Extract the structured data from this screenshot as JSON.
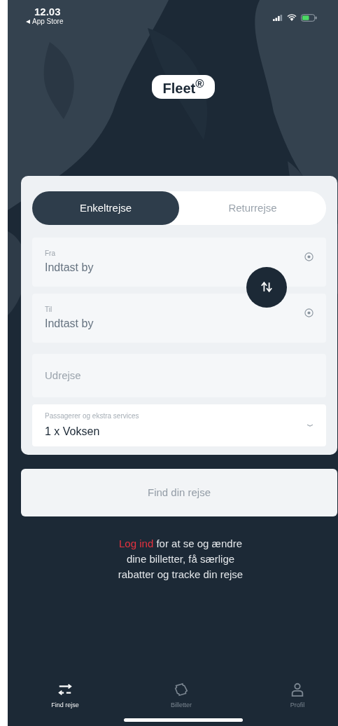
{
  "status_bar": {
    "time": "12.03",
    "back_label": "App Store"
  },
  "logo": {
    "text": "Fleet$^{®}$"
  },
  "trip_types": [
    {
      "label": "Enkeltrejse",
      "selected": true
    },
    {
      "label": "Returrejse",
      "selected": false
    }
  ],
  "fields": [
    {
      "kind": "location",
      "label": "Fra",
      "placeholder": "Indtast by"
    },
    {
      "kind": "location",
      "label": "Til",
      "placeholder": "Indtast by"
    },
    {
      "kind": "date",
      "placeholder": "Udrejse"
    },
    {
      "kind": "dropdown",
      "label": "Passagerer og ekstra services",
      "value": "1 x Voksen"
    }
  ],
  "find_button": {
    "label": "Find din rejse",
    "disabled": true
  },
  "login_prompt": {
    "link": "Log ind",
    "text": "for at se og ændre dine billetter, få særlige rabatter og tracke din rejse"
  },
  "tab_bar": [
    {
      "kind": "search",
      "label": "Find rejse",
      "selected": true
    },
    {
      "kind": "tickets",
      "label": "Billetter",
      "selected": false
    },
    {
      "kind": "profile",
      "label": "Profil",
      "selected": false
    }
  ]
}
